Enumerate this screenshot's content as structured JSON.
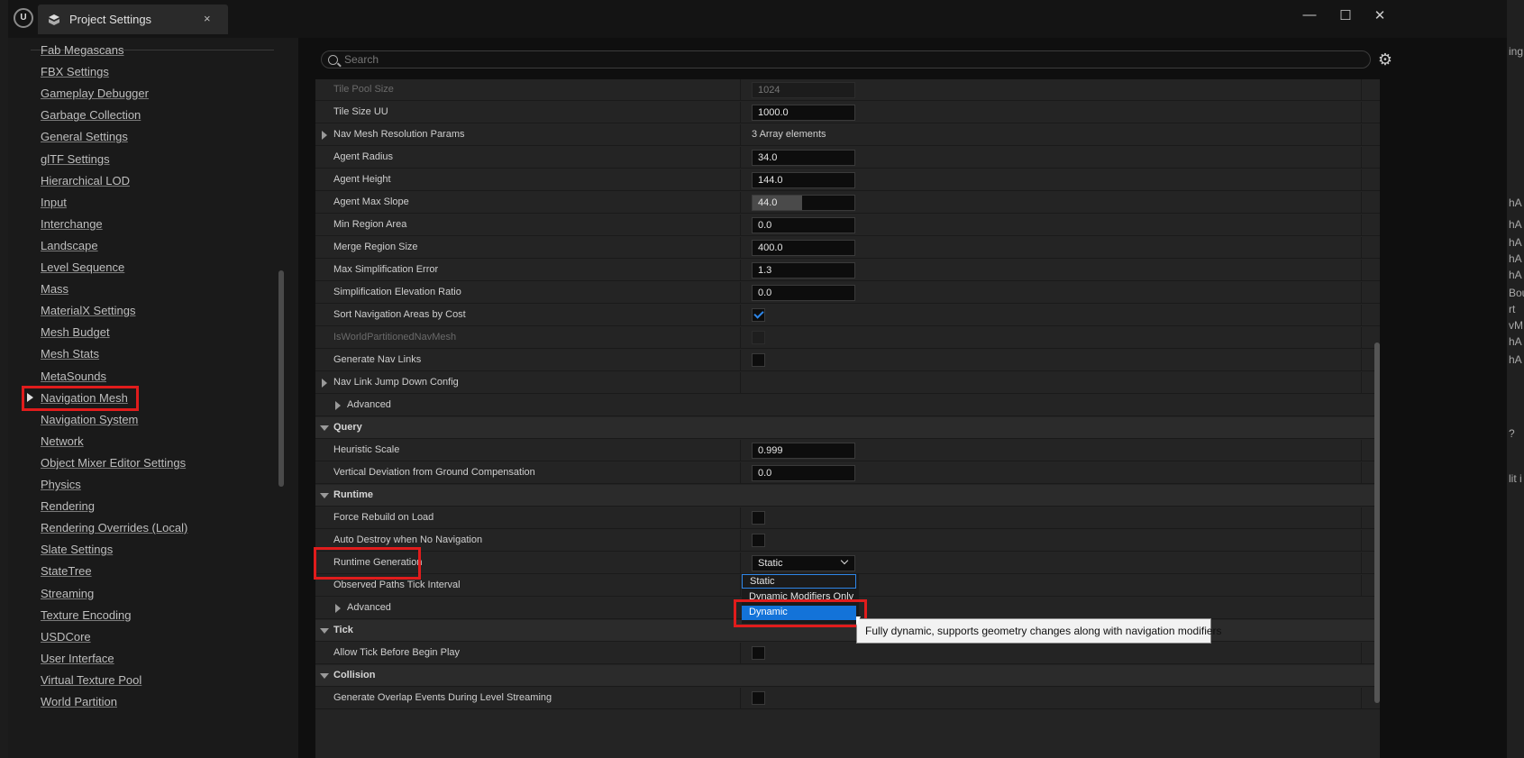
{
  "window": {
    "title": "Project Settings",
    "close_glyph": "×",
    "controls": {
      "minimize": "—",
      "maximize": "☐",
      "close": "✕"
    },
    "logo": "U"
  },
  "search": {
    "placeholder": "Search"
  },
  "sidebar": {
    "items": [
      "Fab Megascans",
      "FBX Settings",
      "Gameplay Debugger",
      "Garbage Collection",
      "General Settings",
      "glTF Settings",
      "Hierarchical LOD",
      "Input",
      "Interchange",
      "Landscape",
      "Level Sequence",
      "Mass",
      "MaterialX Settings",
      "Mesh Budget",
      "Mesh Stats",
      "MetaSounds",
      "Navigation Mesh",
      "Navigation System",
      "Network",
      "Object Mixer Editor Settings",
      "Physics",
      "Rendering",
      "Rendering Overrides (Local)",
      "Slate Settings",
      "StateTree",
      "Streaming",
      "Texture Encoding",
      "USDCore",
      "User Interface",
      "Virtual Texture Pool",
      "World Partition"
    ],
    "selected": "Navigation Mesh"
  },
  "properties": {
    "tile_pool_size": {
      "label": "Tile Pool Size",
      "value": "1024"
    },
    "tile_size_uu": {
      "label": "Tile Size UU",
      "value": "1000.0"
    },
    "nav_mesh_resolution_params": {
      "label": "Nav Mesh Resolution Params",
      "value": "3 Array elements"
    },
    "agent_radius": {
      "label": "Agent Radius",
      "value": "34.0"
    },
    "agent_height": {
      "label": "Agent Height",
      "value": "144.0"
    },
    "agent_max_slope": {
      "label": "Agent Max Slope",
      "value": "44.0",
      "fill_fraction": 0.49
    },
    "min_region_area": {
      "label": "Min Region Area",
      "value": "0.0"
    },
    "merge_region_size": {
      "label": "Merge Region Size",
      "value": "400.0"
    },
    "max_simplification_error": {
      "label": "Max Simplification Error",
      "value": "1.3"
    },
    "simplification_elevation_ratio": {
      "label": "Simplification Elevation Ratio",
      "value": "0.0"
    },
    "sort_navigation_areas_by_cost": {
      "label": "Sort Navigation Areas by Cost",
      "checked": true
    },
    "is_world_partitioned_nav_mesh": {
      "label": "IsWorldPartitionedNavMesh",
      "checked": false
    },
    "generate_nav_links": {
      "label": "Generate Nav Links",
      "checked": false
    },
    "nav_link_jump_down_config": {
      "label": "Nav Link Jump Down Config"
    },
    "advanced_1": {
      "label": "Advanced"
    },
    "query": {
      "label": "Query"
    },
    "heuristic_scale": {
      "label": "Heuristic Scale",
      "value": "0.999"
    },
    "vertical_deviation": {
      "label": "Vertical Deviation from Ground Compensation",
      "value": "0.0"
    },
    "runtime": {
      "label": "Runtime"
    },
    "force_rebuild_on_load": {
      "label": "Force Rebuild on Load",
      "checked": false
    },
    "auto_destroy": {
      "label": "Auto Destroy when No Navigation",
      "checked": false
    },
    "runtime_generation": {
      "label": "Runtime Generation",
      "value": "Static"
    },
    "observed_paths_tick_interval": {
      "label": "Observed Paths Tick Interval"
    },
    "advanced_2": {
      "label": "Advanced"
    },
    "tick": {
      "label": "Tick"
    },
    "allow_tick_before_begin_play": {
      "label": "Allow Tick Before Begin Play",
      "checked": false
    },
    "collision": {
      "label": "Collision"
    },
    "generate_overlap_events": {
      "label": "Generate Overlap Events During Level Streaming",
      "checked": false
    }
  },
  "dropdown": {
    "options": [
      "Static",
      "Dynamic Modifiers Only",
      "Dynamic"
    ],
    "current": "Static",
    "highlighted": "Dynamic"
  },
  "tooltip": {
    "text": "Fully dynamic, supports geometry changes along with navigation modifiers"
  },
  "background_right": {
    "texts": [
      "ing",
      "hA",
      "hA",
      "hA",
      "hA",
      "hA",
      "Bou",
      "rt",
      "vM",
      "hA",
      "hA",
      "?",
      "lit i"
    ]
  },
  "colors": {
    "highlight_red": "#e01c1c",
    "accent_blue": "#1373d9",
    "check_blue": "#2e86e8"
  }
}
